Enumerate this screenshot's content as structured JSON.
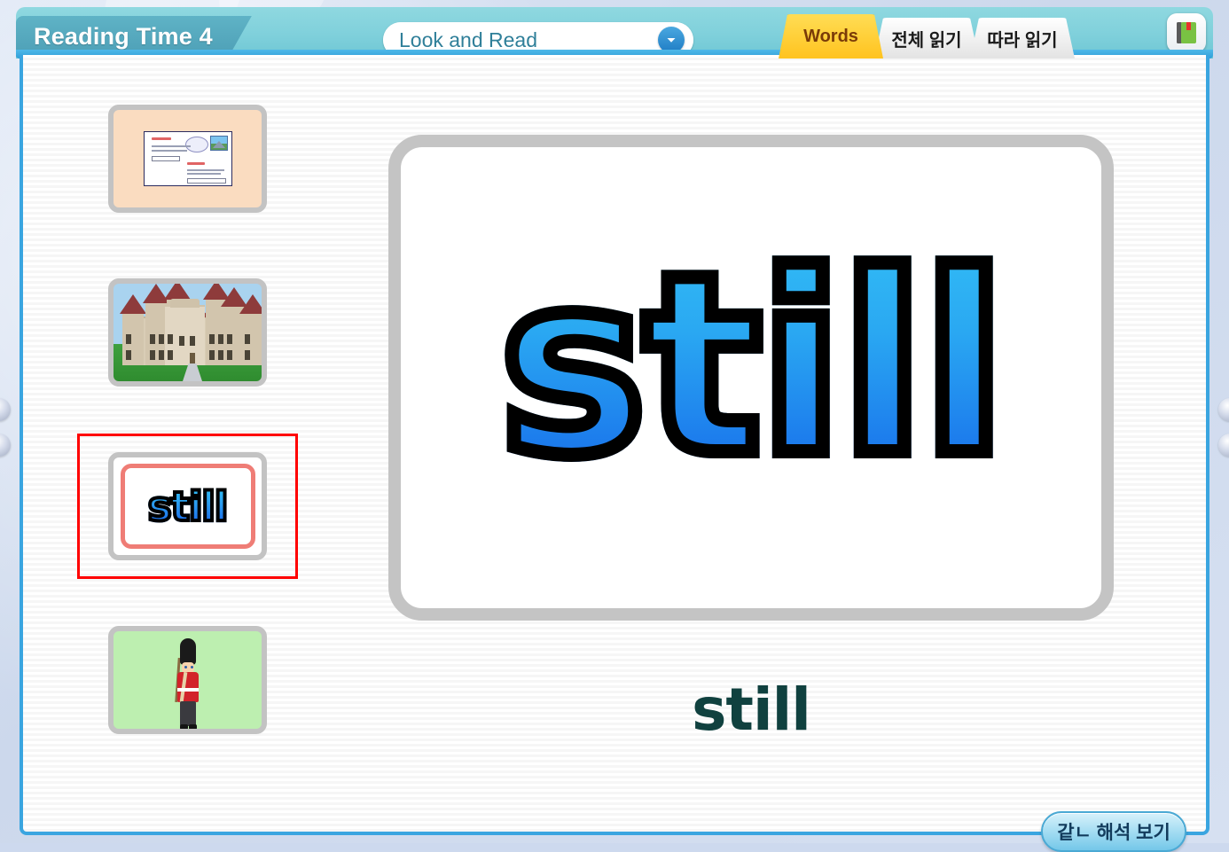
{
  "header": {
    "title": "Reading Time 4",
    "dropdown": {
      "value": "Look and Read",
      "icon": "chevron-down-icon"
    },
    "tabs": [
      {
        "label": "Words",
        "active": true
      },
      {
        "label": "전체 읽기",
        "active": false
      },
      {
        "label": "따라 읽기",
        "active": false
      }
    ],
    "book_button_icon": "book-icon"
  },
  "sidebar": {
    "thumbnails": [
      {
        "name": "envelope-thumbnail",
        "kind": "letter-envelope",
        "selected": false,
        "background": "#fadcc0"
      },
      {
        "name": "castle-thumbnail",
        "kind": "castle-illustration",
        "selected": false,
        "background": "#a9d3ef"
      },
      {
        "name": "still-word-thumbnail",
        "kind": "word-card",
        "word": "still",
        "selected": true,
        "background": "#ffffff"
      },
      {
        "name": "guard-thumbnail",
        "kind": "royal-guard-illustration",
        "selected": false,
        "background": "#bdefb0"
      }
    ]
  },
  "main": {
    "big_word": "still",
    "caption_word": "still",
    "translate_button": "같ㄴ 해석 보기"
  },
  "colors": {
    "header_band": "#7fd0db",
    "title_banner": "#4d9fb6",
    "active_tab": "#ffc31f",
    "active_tab_text": "#7a3b08",
    "panel_border": "#3aa5e0",
    "card_border": "#c4c4c4",
    "word_gradient_top": "#3ad0f8",
    "word_gradient_bottom": "#0e4fd8",
    "word_outline": "#000000",
    "caption_color": "#10413f",
    "selection_outline": "#ff0000",
    "thumb_inner_border": "#ef7d76"
  }
}
